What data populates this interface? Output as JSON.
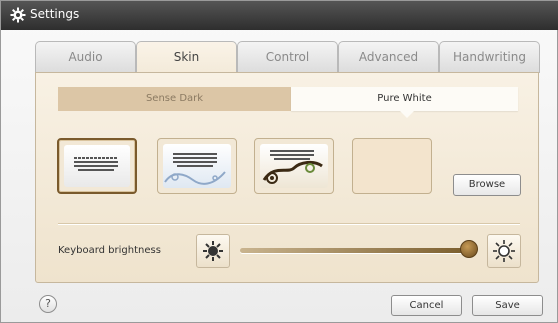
{
  "window": {
    "title": "Settings"
  },
  "tabs": [
    {
      "label": "Audio",
      "active": false
    },
    {
      "label": "Skin",
      "active": true
    },
    {
      "label": "Control",
      "active": false
    },
    {
      "label": "Advanced",
      "active": false
    },
    {
      "label": "Handwriting",
      "active": false
    }
  ],
  "theme_toggle": {
    "dark_label": "Sense Dark",
    "white_label": "Pure White",
    "selected": "Pure White"
  },
  "skins": {
    "selected_index": 0,
    "count": 4
  },
  "browse_label": "Browse",
  "brightness": {
    "label": "Keyboard brightness",
    "level": 1.0
  },
  "footer": {
    "help_label": "?",
    "cancel_label": "Cancel",
    "save_label": "Save"
  },
  "colors": {
    "titlebar": "#3a3a3a",
    "panel": "#f3e9d6",
    "accent": "#7a5a2c",
    "sense_dark_tab": "#dcc6a6"
  }
}
